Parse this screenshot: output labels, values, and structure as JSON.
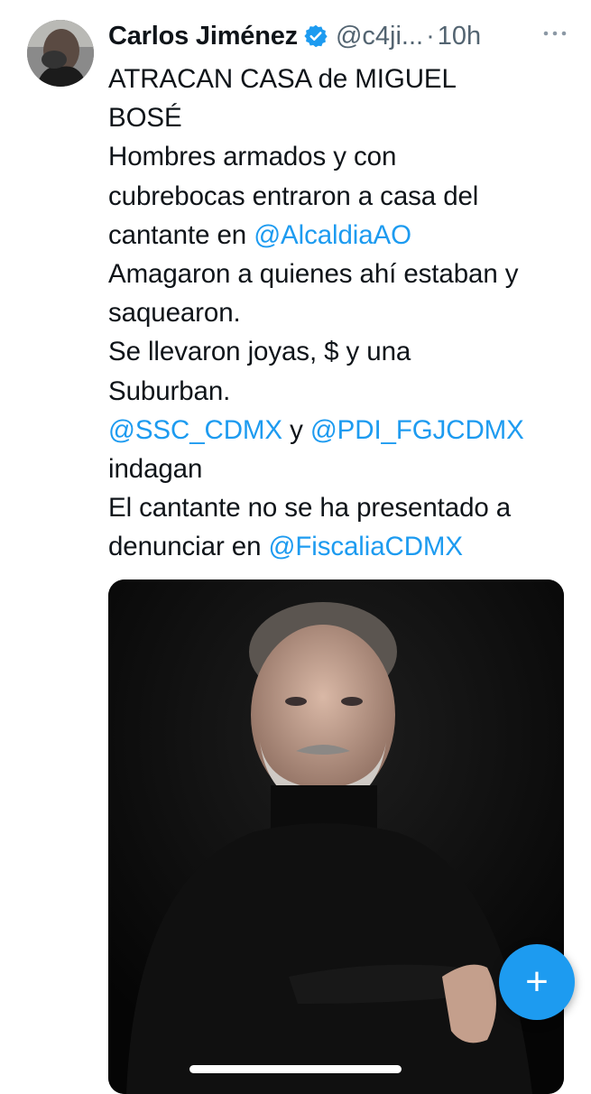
{
  "author": {
    "name": "Carlos Jiménez",
    "handle": "@c4ji...",
    "separator": "·",
    "time": "10h",
    "verified_color": "#1d9bf0"
  },
  "tweet": {
    "lines": [
      [
        {
          "text": "ATRACAN CASA de MIGUEL"
        }
      ],
      [
        {
          "text": "BOSÉ"
        }
      ],
      [
        {
          "text": "Hombres armados y con"
        }
      ],
      [
        {
          "text": "cubrebocas entraron a casa del"
        }
      ],
      [
        {
          "text": "cantante en "
        },
        {
          "text": "@AlcaldiaAO",
          "mention": true
        }
      ],
      [
        {
          "text": "Amagaron a quienes ahí estaban y"
        }
      ],
      [
        {
          "text": "saquearon."
        }
      ],
      [
        {
          "text": "Se llevaron joyas, $ y una"
        }
      ],
      [
        {
          "text": "Suburban."
        }
      ],
      [
        {
          "text": "@SSC_CDMX",
          "mention": true
        },
        {
          "text": " y "
        },
        {
          "text": "@PDI_FGJCDMX",
          "mention": true
        }
      ],
      [
        {
          "text": "indagan"
        }
      ],
      [
        {
          "text": "El cantante no se ha presentado a"
        }
      ],
      [
        {
          "text": "denunciar en "
        },
        {
          "text": "@FiscaliaCDMX",
          "mention": true
        }
      ]
    ]
  },
  "media": {
    "kind": "portrait photo",
    "background": "#0b0b0b"
  },
  "compose_button": {
    "label": "+",
    "color": "#1d9bf0"
  },
  "icons": {
    "verified": "verified-badge-icon",
    "more": "more-options-icon"
  }
}
